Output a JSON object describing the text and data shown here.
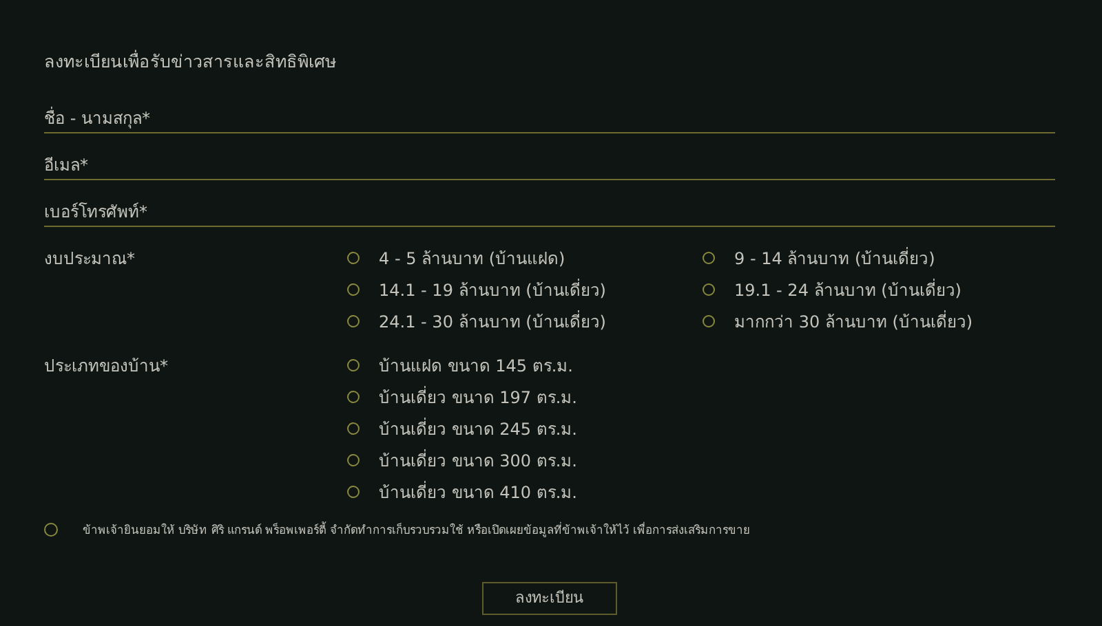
{
  "title": "ลงทะเบียนเพื่อรับข่าวสารและสิทธิพิเศษ",
  "fields": [
    {
      "placeholder": "ชื่อ - นามสกุล*"
    },
    {
      "placeholder": "อีเมล*"
    },
    {
      "placeholder": "เบอร์โทรศัพท์*"
    }
  ],
  "budget": {
    "label": "งบประมาณ*",
    "options": [
      {
        "label": "4 - 5 ล้านบาท (บ้านแฝด)",
        "selected": false
      },
      {
        "label": "9 - 14 ล้านบาท (บ้านเดี่ยว)",
        "selected": false
      },
      {
        "label": "14.1 - 19 ล้านบาท (บ้านเดี่ยว)",
        "selected": false
      },
      {
        "label": "19.1 - 24 ล้านบาท (บ้านเดี่ยว)",
        "selected": false
      },
      {
        "label": "24.1 - 30 ล้านบาท (บ้านเดี่ยว)",
        "selected": false
      },
      {
        "label": "มากกว่า 30 ล้านบาท (บ้านเดี่ยว)",
        "selected": false
      }
    ]
  },
  "house_type": {
    "label": "ประเภทของบ้าน*",
    "options": [
      {
        "label": "บ้านแฝด ขนาด 145 ตร.ม.",
        "selected": false
      },
      {
        "label": "บ้านเดี่ยว ขนาด 197 ตร.ม.",
        "selected": false
      },
      {
        "label": "บ้านเดี่ยว ขนาด 245 ตร.ม.",
        "selected": false
      },
      {
        "label": "บ้านเดี่ยว ขนาด 300 ตร.ม.",
        "selected": false
      },
      {
        "label": "บ้านเดี่ยว ขนาด 410 ตร.ม.",
        "selected": false
      }
    ]
  },
  "consent": {
    "text": "ข้าพเจ้ายินยอมให้ บริษัท ศิริ แกรนด์ พร็อพเพอร์ตี้ จำกัดทำการเก็บรวบรวมใช้ หรือเปิดเผยข้อมูลที่ข้าพเจ้าให้ไว้ เพื่อการส่งเสริมการขาย",
    "checked": false
  },
  "submit": "ลงทะเบียน"
}
